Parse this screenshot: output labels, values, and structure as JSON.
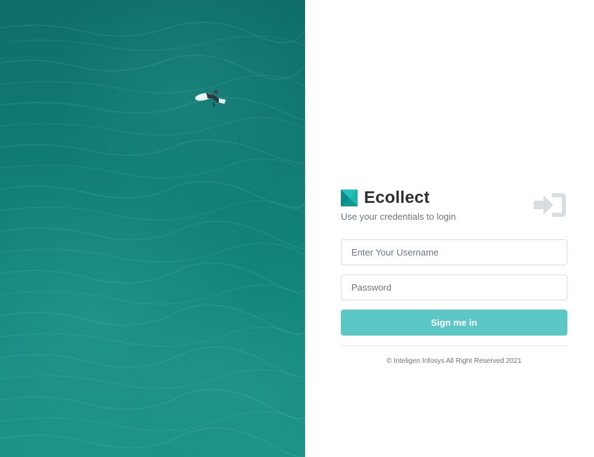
{
  "background_photo": {
    "description_icon": "ocean-surfer-photo"
  },
  "brand": {
    "name": "Ecollect",
    "logo_icon": "ecollect-logo-icon",
    "logo_color": "#14a39d"
  },
  "login": {
    "subtitle": "Use your credentials to login",
    "username_placeholder": "Enter Your Username",
    "password_placeholder": "Password",
    "submit_label": "Sign me in",
    "signin_icon": "sign-in-icon",
    "button_color": "#5cc8c5"
  },
  "footer": {
    "copyright": "© Inteligen Infosys All Right Reserved 2021"
  }
}
